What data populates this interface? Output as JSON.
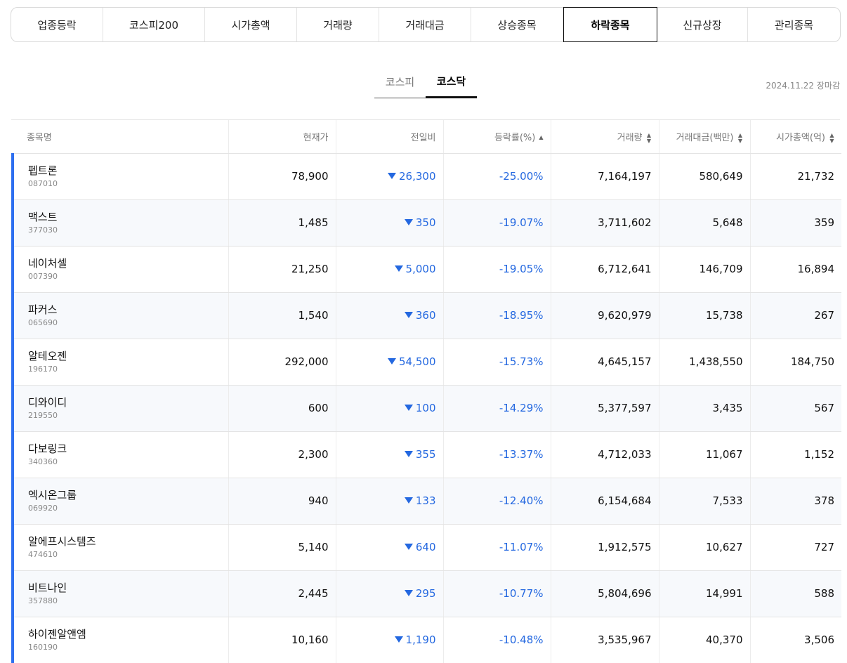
{
  "categories": [
    {
      "label": "업종등락",
      "active": false
    },
    {
      "label": "코스피200",
      "active": false
    },
    {
      "label": "시가총액",
      "active": false
    },
    {
      "label": "거래량",
      "active": false
    },
    {
      "label": "거래대금",
      "active": false
    },
    {
      "label": "상승종목",
      "active": false
    },
    {
      "label": "하락종목",
      "active": true
    },
    {
      "label": "신규상장",
      "active": false
    },
    {
      "label": "관리종목",
      "active": false
    }
  ],
  "market_tabs": [
    {
      "label": "코스피",
      "active": false
    },
    {
      "label": "코스닥",
      "active": true
    }
  ],
  "date_note": "2024.11.22 장마감",
  "columns": {
    "name": "종목명",
    "price": "현재가",
    "change": "전일비",
    "rate": "등락률(%)",
    "volume": "거래량",
    "amount": "거래대금(백만)",
    "market_cap": "시가총액(억)"
  },
  "sort_icons": {
    "rate": "▲",
    "volume": "▲▼",
    "amount": "▲▼",
    "market_cap": "▲▼"
  },
  "colors": {
    "down": "#2468e0",
    "row_marker": "#2d6ff0"
  },
  "rows": [
    {
      "name": "펩트론",
      "code": "087010",
      "price": "78,900",
      "change": "26,300",
      "rate": "-25.00%",
      "volume": "7,164,197",
      "amount": "580,649",
      "market_cap": "21,732"
    },
    {
      "name": "맥스트",
      "code": "377030",
      "price": "1,485",
      "change": "350",
      "rate": "-19.07%",
      "volume": "3,711,602",
      "amount": "5,648",
      "market_cap": "359"
    },
    {
      "name": "네이처셀",
      "code": "007390",
      "price": "21,250",
      "change": "5,000",
      "rate": "-19.05%",
      "volume": "6,712,641",
      "amount": "146,709",
      "market_cap": "16,894"
    },
    {
      "name": "파커스",
      "code": "065690",
      "price": "1,540",
      "change": "360",
      "rate": "-18.95%",
      "volume": "9,620,979",
      "amount": "15,738",
      "market_cap": "267"
    },
    {
      "name": "알테오젠",
      "code": "196170",
      "price": "292,000",
      "change": "54,500",
      "rate": "-15.73%",
      "volume": "4,645,157",
      "amount": "1,438,550",
      "market_cap": "184,750"
    },
    {
      "name": "디와이디",
      "code": "219550",
      "price": "600",
      "change": "100",
      "rate": "-14.29%",
      "volume": "5,377,597",
      "amount": "3,435",
      "market_cap": "567"
    },
    {
      "name": "다보링크",
      "code": "340360",
      "price": "2,300",
      "change": "355",
      "rate": "-13.37%",
      "volume": "4,712,033",
      "amount": "11,067",
      "market_cap": "1,152"
    },
    {
      "name": "엑시온그룹",
      "code": "069920",
      "price": "940",
      "change": "133",
      "rate": "-12.40%",
      "volume": "6,154,684",
      "amount": "7,533",
      "market_cap": "378"
    },
    {
      "name": "알에프시스템즈",
      "code": "474610",
      "price": "5,140",
      "change": "640",
      "rate": "-11.07%",
      "volume": "1,912,575",
      "amount": "10,627",
      "market_cap": "727"
    },
    {
      "name": "비트나인",
      "code": "357880",
      "price": "2,445",
      "change": "295",
      "rate": "-10.77%",
      "volume": "5,804,696",
      "amount": "14,991",
      "market_cap": "588"
    },
    {
      "name": "하이젠알앤엠",
      "code": "160190",
      "price": "10,160",
      "change": "1,190",
      "rate": "-10.48%",
      "volume": "3,535,967",
      "amount": "40,370",
      "market_cap": "3,506"
    }
  ]
}
